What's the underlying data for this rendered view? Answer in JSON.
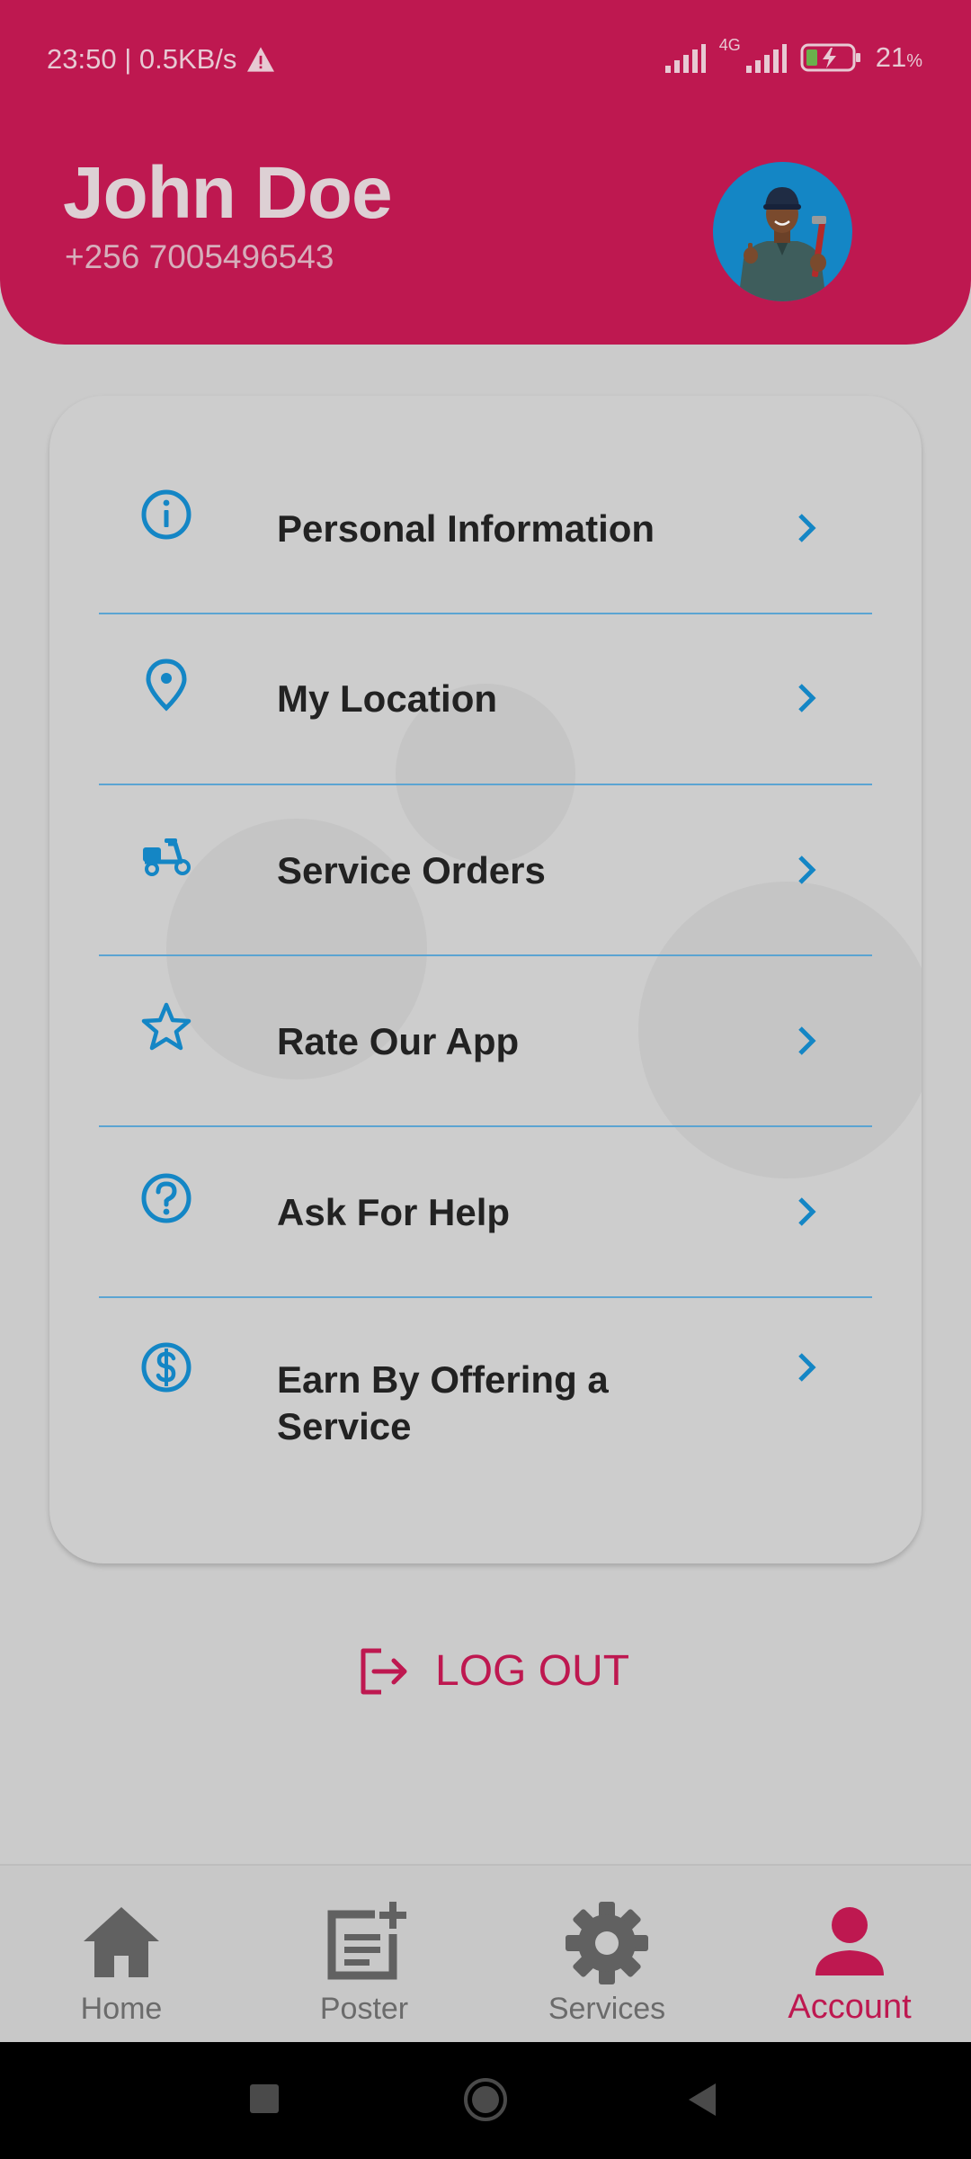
{
  "status_bar": {
    "time_speed": "23:50 | 0.5KB/s",
    "warning_icon": "warning-icon",
    "network_type": "4G",
    "battery": "21",
    "battery_unit": "%"
  },
  "profile": {
    "name": "John Doe",
    "phone": "+256 7005496543",
    "avatar_icon": "plumber-avatar"
  },
  "menu": {
    "items": [
      {
        "label": "Personal Information",
        "icon": "info-icon"
      },
      {
        "label": "My Location",
        "icon": "location-pin-icon"
      },
      {
        "label": "Service Orders",
        "icon": "scooter-icon"
      },
      {
        "label": "Rate Our App",
        "icon": "star-icon"
      },
      {
        "label": "Ask For Help",
        "icon": "help-icon"
      },
      {
        "label": "Earn By Offering a Service",
        "icon": "dollar-icon"
      }
    ]
  },
  "logout": {
    "label": "LOG OUT",
    "icon": "logout-icon"
  },
  "bottom_nav": {
    "items": [
      {
        "label": "Home",
        "icon": "home-icon"
      },
      {
        "label": "Poster",
        "icon": "post-add-icon"
      },
      {
        "label": "Services",
        "icon": "gear-icon"
      },
      {
        "label": "Account",
        "icon": "person-icon"
      }
    ],
    "active": "Account"
  },
  "colors": {
    "primary": "#be1850",
    "accent": "#1486c5",
    "background": "#cbcbcb",
    "inactive": "#6b6b6b"
  }
}
